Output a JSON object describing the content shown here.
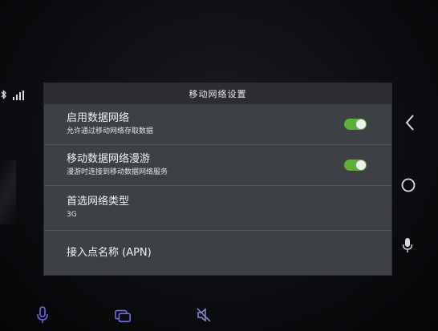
{
  "window": {
    "title": "移动网络设置"
  },
  "settings": [
    {
      "title": "启用数据网络",
      "subtitle": "允许通过移动网络存取数据",
      "toggle": "on"
    },
    {
      "title": "移动数据网络漫游",
      "subtitle": "漫游时连接到移动数据网络服务",
      "toggle": "on"
    },
    {
      "title": "首选网络类型",
      "subtitle": "3G"
    },
    {
      "title": "接入点名称 (APN)",
      "subtitle": ""
    }
  ],
  "colors": {
    "panel_bg": "#3d4044",
    "header_bg": "#2b2d31",
    "toggle_on": "#5fae3a",
    "bottom_icon": "#5b5bd8"
  },
  "icons": {
    "status": [
      "bluetooth-icon",
      "signal-icon"
    ],
    "nav": [
      "back-icon",
      "home-icon",
      "microphone-icon"
    ],
    "bottom": [
      "microphone-icon",
      "cast-icon",
      "mute-icon"
    ]
  }
}
